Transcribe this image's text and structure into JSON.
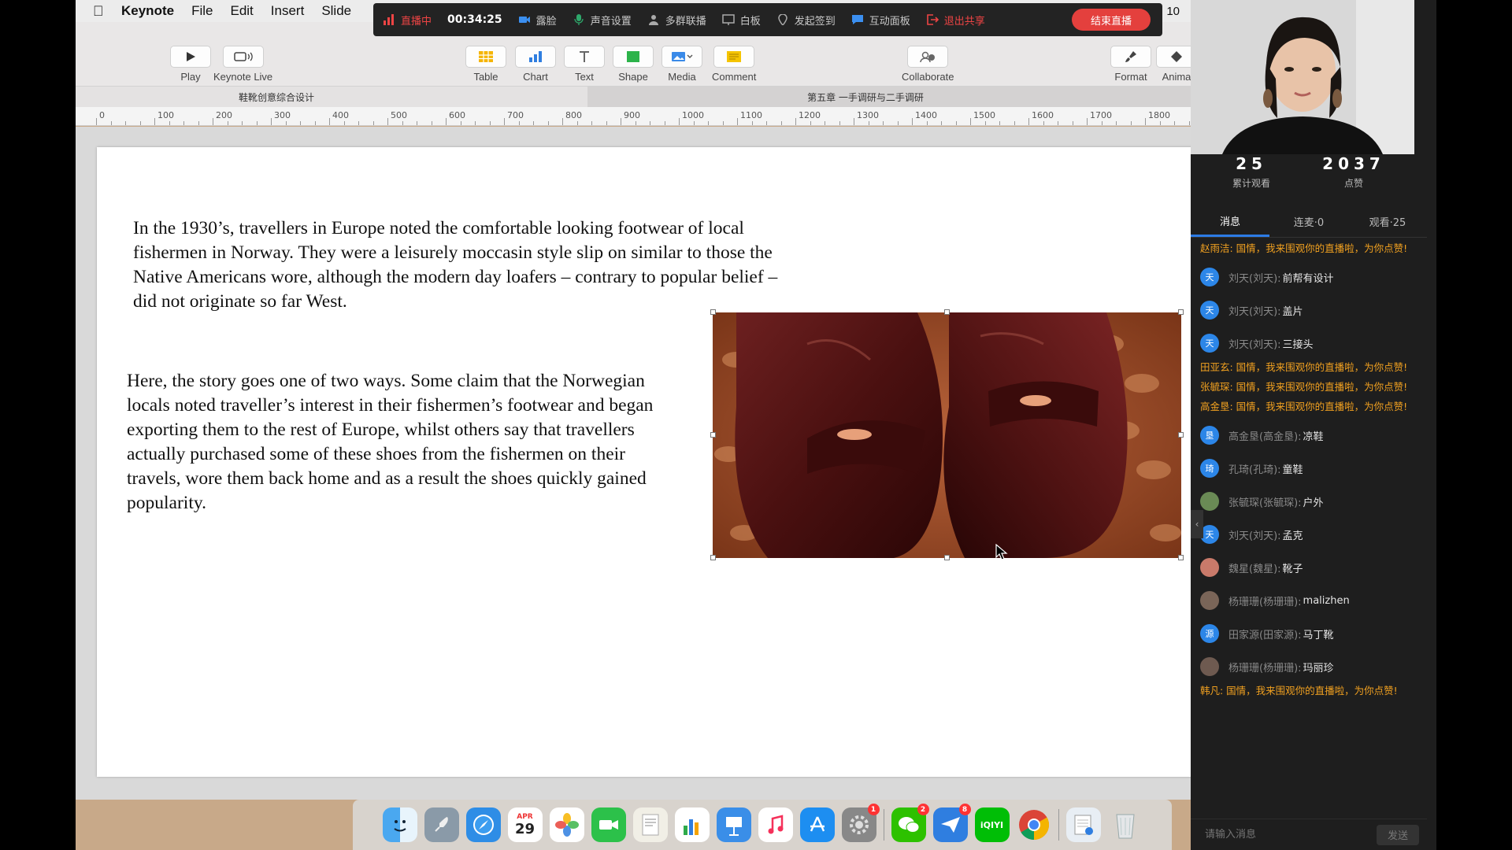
{
  "menubar": {
    "app": "Keynote",
    "items": [
      "File",
      "Edit",
      "Insert",
      "Slide"
    ],
    "right_text": "10"
  },
  "livebar": {
    "status": "直播中",
    "timer": "00:34:25",
    "items": [
      "露脸",
      "声音设置",
      "多群联播",
      "白板",
      "发起签到",
      "互动面板"
    ],
    "exit": "退出共享",
    "end_button": "结束直播"
  },
  "toolbar": {
    "play": "Play",
    "keynote_live": "Keynote Live",
    "table": "Table",
    "chart": "Chart",
    "text": "Text",
    "shape": "Shape",
    "media": "Media",
    "comment": "Comment",
    "collaborate": "Collaborate",
    "format": "Format",
    "animate": "Anima"
  },
  "tabs": {
    "doc1": "鞋靴创意综合设计",
    "doc2": "第五章 一手调研与二手调研"
  },
  "ruler": {
    "ticks": [
      "0",
      "100",
      "200",
      "300",
      "400",
      "500",
      "600",
      "700",
      "800",
      "900",
      "1000",
      "1100",
      "1200",
      "1300",
      "1400",
      "1500",
      "1600",
      "1700",
      "1800"
    ]
  },
  "slide": {
    "para1": "In the 1930’s, travellers in Europe noted the comfortable looking footwear of local fishermen in Norway. They were a leisurely moccasin style slip on similar to those the Native Americans wore, although the modern day loafers – contrary to popular belief – did not originate so far West.",
    "para2": "Here, the story goes one of two ways. Some claim that the Norwegian locals noted traveller’s interest in their fishermen’s footwear and began exporting them to the rest of Europe, whilst others say that travellers actually purchased some of these shoes from the fishermen on their travels, wore them back home and as a result the shoes quickly gained popularity."
  },
  "dock": {
    "calendar_month": "APR",
    "calendar_day": "29",
    "badges": {
      "settings": "1",
      "wechat": "2",
      "feishu": "8"
    },
    "iqiyi": "iQIYI"
  },
  "panel": {
    "stats": [
      {
        "num": "25",
        "label": "累计观看"
      },
      {
        "num": "2037",
        "label": "点赞"
      }
    ],
    "tabs": [
      "消息",
      "连麦·0",
      "观看·25"
    ],
    "messages": [
      {
        "type": "sys",
        "text": "赵雨洁: 国情，我来围观你的直播啦，为你点赞!"
      },
      {
        "type": "user",
        "avatar": "天",
        "color": "#2c86e8",
        "name": "刘天(刘天):",
        "text": "前帮有设计"
      },
      {
        "type": "user",
        "avatar": "天",
        "color": "#2c86e8",
        "name": "刘天(刘天):",
        "text": "盖片"
      },
      {
        "type": "user",
        "avatar": "天",
        "color": "#2c86e8",
        "name": "刘天(刘天):",
        "text": "三接头"
      },
      {
        "type": "sys",
        "text": "田亚玄: 国情，我来围观你的直播啦，为你点赞!"
      },
      {
        "type": "sys",
        "text": "张毓琛: 国情，我来围观你的直播啦，为你点赞!"
      },
      {
        "type": "sys",
        "text": "高金垦: 国情，我来围观你的直播啦，为你点赞!"
      },
      {
        "type": "user",
        "avatar": "垦",
        "color": "#2c86e8",
        "name": "高金垦(高金垦):",
        "text": "凉鞋"
      },
      {
        "type": "user",
        "avatar": "琦",
        "color": "#2c86e8",
        "name": "孔琦(孔琦):",
        "text": "童鞋"
      },
      {
        "type": "user",
        "avatar": "",
        "color": "#6a8a55",
        "name": "张毓琛(张毓琛):",
        "text": "户外"
      },
      {
        "type": "user",
        "avatar": "天",
        "color": "#2c86e8",
        "name": "刘天(刘天):",
        "text": "孟克"
      },
      {
        "type": "user",
        "avatar": "",
        "color": "#c97a6a",
        "name": "魏星(魏星):",
        "text": "靴子"
      },
      {
        "type": "user",
        "avatar": "",
        "color": "#7a6558",
        "name": "杨珊珊(杨珊珊):",
        "text": "malizhen"
      },
      {
        "type": "user",
        "avatar": "源",
        "color": "#2c86e8",
        "name": "田家源(田家源):",
        "text": "马丁靴"
      },
      {
        "type": "user",
        "avatar": "",
        "color": "#6e5a50",
        "name": "杨珊珊(杨珊珊):",
        "text": "玛丽珍"
      },
      {
        "type": "sys",
        "text": "韩凡: 国情，我来围观你的直播啦，为你点赞!"
      }
    ],
    "input_placeholder": "请输入消息",
    "send": "发送"
  }
}
